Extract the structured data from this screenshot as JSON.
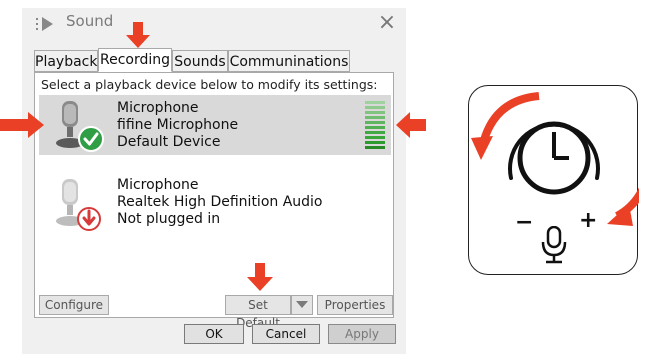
{
  "dialog": {
    "title": "Sound",
    "tabs": [
      {
        "label": "Playback"
      },
      {
        "label": "Recording"
      },
      {
        "label": "Sounds"
      },
      {
        "label": "Communinations"
      }
    ],
    "instruction": "Select a playback device below to modify its settings:",
    "devices": [
      {
        "name": "Microphone",
        "description": "fifine Microphone",
        "status": "Default Device",
        "selected": true,
        "icon": "microphone-default-check-icon"
      },
      {
        "name": "Microphone",
        "description": "Realtek High Definition Audio",
        "status": "Not plugged in",
        "selected": false,
        "icon": "microphone-unplugged-icon"
      }
    ],
    "buttons": {
      "configure": "Configure",
      "set_default": "Set Default",
      "properties": "Properties",
      "ok": "OK",
      "cancel": "Cancel",
      "apply": "Apply"
    }
  },
  "knob": {
    "minus_label": "−",
    "plus_label": "+",
    "mic_icon": "microphone-icon"
  },
  "colors": {
    "accent_arrow": "#ea4026",
    "level_green": "#3aa63a",
    "check_green": "#2f9e44",
    "unplugged_red": "#d63a3a"
  }
}
